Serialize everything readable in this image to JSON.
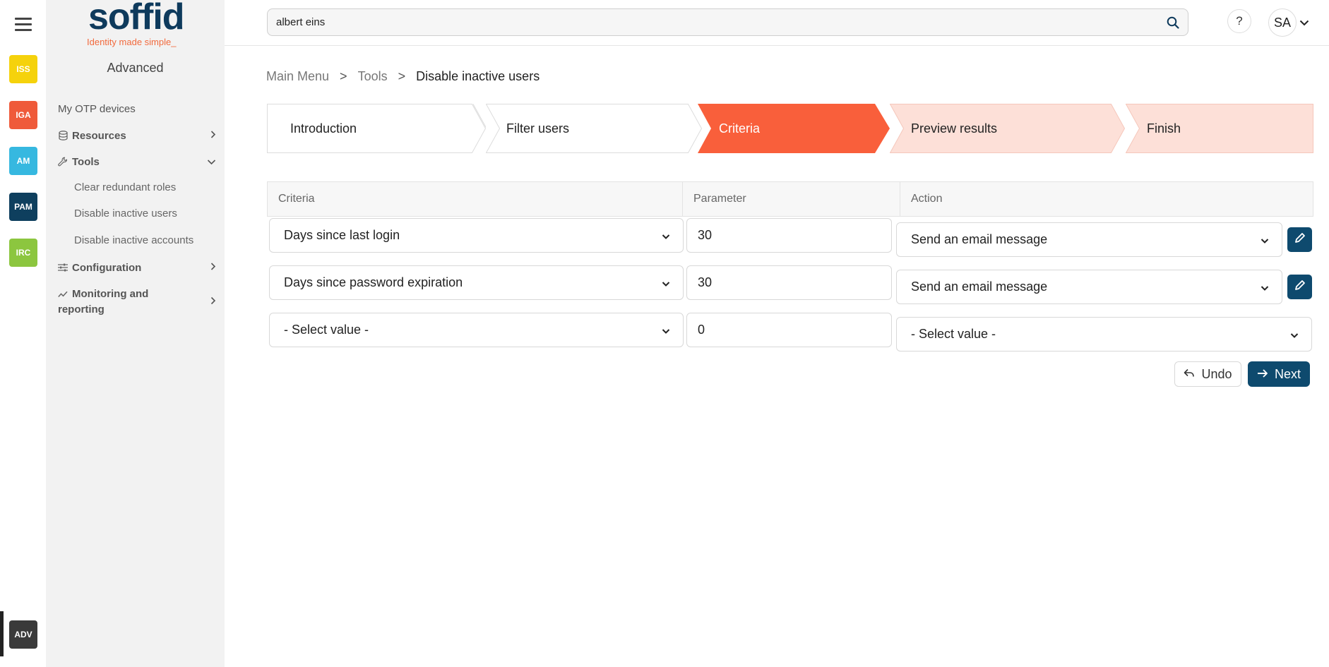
{
  "rail": {
    "apps": [
      {
        "label": "ISS",
        "color": "#f5d20c"
      },
      {
        "label": "IGA",
        "color": "#ef5a3a"
      },
      {
        "label": "AM",
        "color": "#36b8e0"
      },
      {
        "label": "PAM",
        "color": "#0e3f5e"
      },
      {
        "label": "IRC",
        "color": "#8cc63f"
      }
    ],
    "active_app": {
      "label": "ADV",
      "color": "#3a3a3a"
    }
  },
  "sidebar": {
    "logo_text": "soffid",
    "logo_tagline": "Identity made simple_",
    "title": "Advanced",
    "items": [
      {
        "label": "My OTP devices"
      },
      {
        "label": "Resources",
        "icon": "database-icon"
      },
      {
        "label": "Tools",
        "icon": "wrench-icon",
        "expanded": true,
        "children": [
          "Clear redundant roles",
          "Disable inactive users",
          "Disable inactive accounts"
        ]
      },
      {
        "label": "Configuration",
        "icon": "sliders-icon"
      },
      {
        "label": "Monitoring and",
        "label2": "reporting",
        "icon": "chart-line-icon"
      }
    ]
  },
  "topbar": {
    "search_value": "albert eins",
    "help_label": "?",
    "avatar_initials": "SA"
  },
  "breadcrumb": {
    "items": [
      "Main Menu",
      "Tools"
    ],
    "separator": ">",
    "current": "Disable inactive users"
  },
  "wizard": {
    "steps": [
      {
        "label": "Introduction",
        "state": "done"
      },
      {
        "label": "Filter users",
        "state": "done"
      },
      {
        "label": "Criteria",
        "state": "active"
      },
      {
        "label": "Preview results",
        "state": "pending"
      },
      {
        "label": "Finish",
        "state": "pending"
      }
    ],
    "colors": {
      "active": "#f95f3b",
      "pending": "#fde0d8",
      "done": "#ffffff"
    }
  },
  "table": {
    "headers": [
      "Criteria",
      "Parameter",
      "Action"
    ],
    "rows": [
      {
        "criteria": "Days since last login",
        "parameter": "30",
        "action": "Send an email message",
        "editable": true
      },
      {
        "criteria": "Days since password expiration",
        "parameter": "30",
        "action": "Send an email message",
        "editable": true
      },
      {
        "criteria": "- Select value -",
        "parameter": "0",
        "action": "- Select value -",
        "editable": false
      }
    ]
  },
  "buttons": {
    "undo": "Undo",
    "next": "Next"
  },
  "colors": {
    "primary": "#0e4a6e",
    "accent": "#f95f3b"
  }
}
